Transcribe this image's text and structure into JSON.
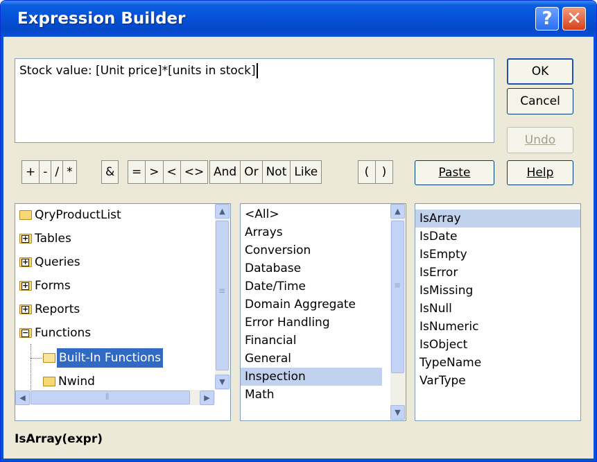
{
  "window": {
    "title": "Expression Builder",
    "help_glyph": "?",
    "close_glyph": "✕"
  },
  "expression": "Stock value: [Unit price]*[units in stock]",
  "buttons": {
    "ok": "OK",
    "cancel": "Cancel",
    "undo": "Undo",
    "paste": "Paste",
    "help": "Help"
  },
  "operators": {
    "arith": [
      "+",
      "-",
      "/",
      "*"
    ],
    "concat": [
      "&"
    ],
    "compare": [
      "=",
      ">",
      "<",
      "<>"
    ],
    "logic": [
      "And",
      "Or",
      "Not",
      "Like"
    ],
    "paren": [
      "(",
      ")"
    ]
  },
  "tree": {
    "items": [
      {
        "label": "QryProductList"
      },
      {
        "label": "Tables"
      },
      {
        "label": "Queries"
      },
      {
        "label": "Forms"
      },
      {
        "label": "Reports"
      },
      {
        "label": "Functions"
      },
      {
        "label": "Built-In Functions"
      },
      {
        "label": "Nwind"
      }
    ],
    "selected": "Built-In Functions"
  },
  "categories": {
    "items": [
      "<All>",
      "Arrays",
      "Conversion",
      "Database",
      "Date/Time",
      "Domain Aggregate",
      "Error Handling",
      "Financial",
      "General",
      "Inspection",
      "Math"
    ],
    "selected": "Inspection"
  },
  "functions": {
    "items": [
      "IsArray",
      "IsDate",
      "IsEmpty",
      "IsError",
      "IsMissing",
      "IsNull",
      "IsNumeric",
      "IsObject",
      "TypeName",
      "VarType"
    ],
    "selected": "IsArray"
  },
  "status": "IsArray(expr)",
  "colors": {
    "title_blue": "#0552d8",
    "selection": "#316ac5",
    "light_selection": "#c1d2ee",
    "face": "#ece9d8"
  }
}
